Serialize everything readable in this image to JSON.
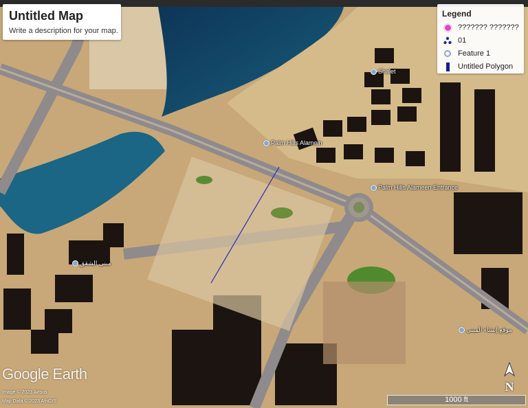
{
  "map": {
    "title": "Untitled Map",
    "description": "Write a description for your map."
  },
  "legend": {
    "heading": "Legend",
    "items": [
      {
        "label": "??????? ???????",
        "icon": "pink-marker-icon",
        "color": "#e83fd0"
      },
      {
        "label": "01",
        "icon": "cluster-icon",
        "color": "#1d2e8f"
      },
      {
        "label": "Feature 1",
        "icon": "placemark-icon",
        "color": "#8aa7c8"
      },
      {
        "label": "Untitled Polygon",
        "icon": "polygon-icon",
        "color": "#1a1a9a"
      }
    ]
  },
  "places": [
    {
      "label": "Shalet"
    },
    {
      "label": "Palm Hills Alamein"
    },
    {
      "label": "Palm Hills Alameen Entrance"
    },
    {
      "label": "مبنى الشقق"
    },
    {
      "label": "موقع إنشاء المبنى"
    }
  ],
  "branding": {
    "logo": "Google Earth"
  },
  "attribution": {
    "imagery": "Image © 2023 Airbus",
    "map_data": "Map Data © 2023 AfriGIS"
  },
  "scale": {
    "label": "1000 ft"
  },
  "compass": {
    "label": "N"
  }
}
